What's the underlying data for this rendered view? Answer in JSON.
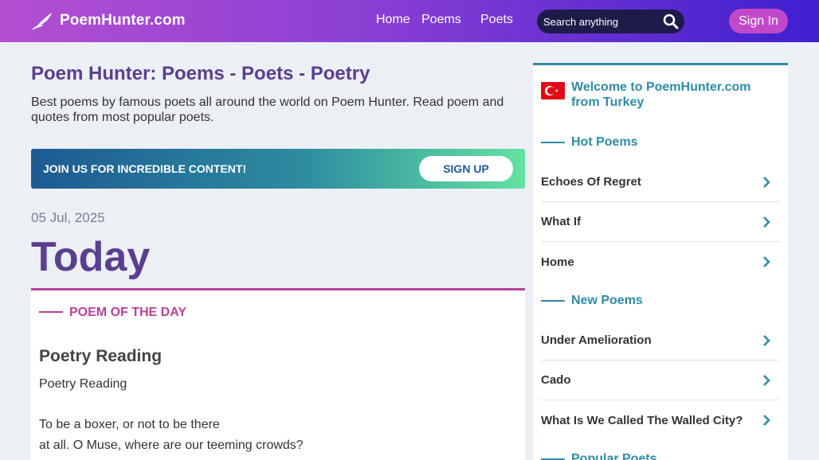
{
  "header": {
    "logo_text": "PoemHunter.com",
    "nav": [
      "Home",
      "Poems",
      "Poets"
    ],
    "search_placeholder": "Search anything",
    "signin_label": "Sign In"
  },
  "main": {
    "site_title": "Poem Hunter: Poems - Poets - Poetry",
    "site_desc": "Best poems by famous poets all around the world on Poem Hunter. Read poem and quotes from most popular poets.",
    "join_text": "JOIN US FOR INCREDIBLE CONTENT!",
    "signup_label": "SIGN UP",
    "date": "05 Jul, 2025",
    "today_label": "Today",
    "potd_label": "POEM OF THE DAY",
    "poem_title": "Poetry Reading",
    "poem_lines": [
      "Poetry Reading",
      "",
      "To be a boxer, or not to be there",
      "at all. O Muse, where are our teeming crowds?"
    ]
  },
  "sidebar": {
    "welcome": "Welcome to PoemHunter.com from Turkey",
    "hot_label": "Hot Poems",
    "hot_items": [
      "Echoes Of Regret",
      "What If",
      "Home"
    ],
    "new_label": "New Poems",
    "new_items": [
      "Under Amelioration",
      "Cado",
      "What Is We Called The Walled City?"
    ],
    "popular_label": "Popular Poets"
  },
  "colors": {
    "brand_purple": "#5b3f8f",
    "accent_teal": "#2e8ba5",
    "accent_magenta": "#b8419b",
    "signin_pink": "#c149c9"
  },
  "icons": [
    "quill-icon",
    "search-icon",
    "turkey-flag-icon",
    "chevron-right-icon"
  ]
}
